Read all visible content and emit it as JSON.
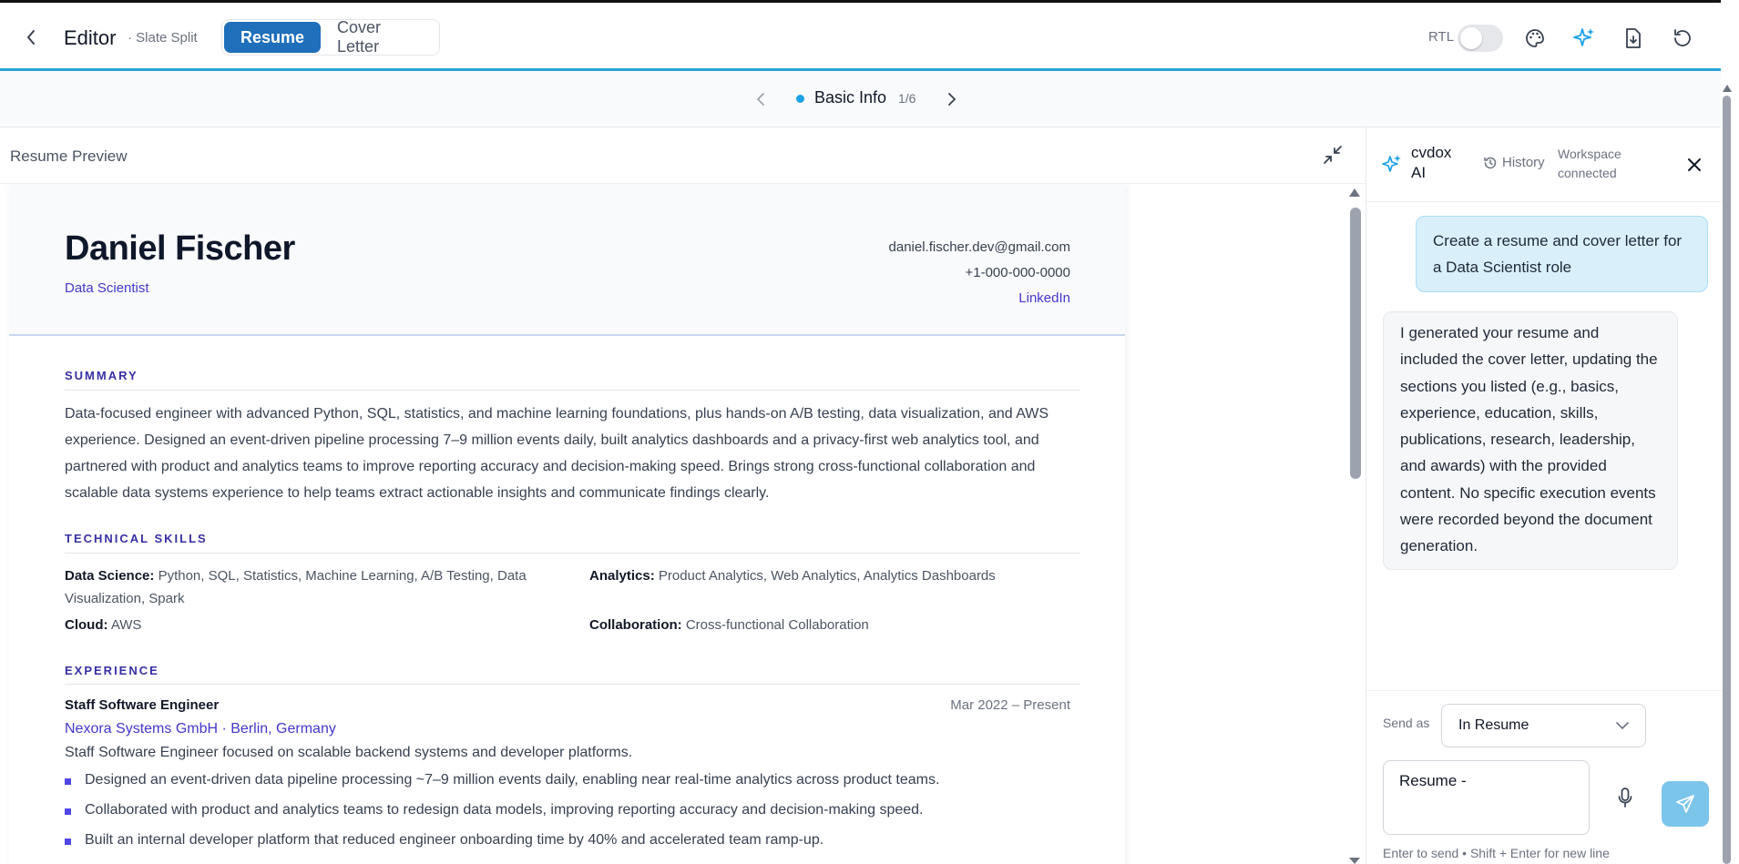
{
  "topbar": {
    "title": "Editor",
    "subtitle": "· Slate Split",
    "tabs": [
      "Resume",
      "Cover Letter"
    ],
    "rtl_label": "RTL",
    "accent_color": "#1f6fba"
  },
  "section_nav": {
    "title": "Basic Info",
    "count": "1/6",
    "dot_color": "#1da1e6"
  },
  "preview": {
    "title": "Resume Preview"
  },
  "resume": {
    "name": "Daniel Fischer",
    "role": "Data Scientist",
    "email": "daniel.fischer.dev@gmail.com",
    "phone": "+1-000-000-0000",
    "linkedin": "LinkedIn",
    "summary_title": "SUMMARY",
    "summary": "Data-focused engineer with advanced Python, SQL, statistics, and machine learning foundations, plus hands-on A/B testing, data visualization, and AWS experience. Designed an event-driven pipeline processing 7–9 million events daily, built analytics dashboards and a privacy-first web analytics tool, and partnered with product and analytics teams to improve reporting accuracy and decision-making speed. Brings strong cross-functional collaboration and scalable data systems experience to help teams extract actionable insights and communicate findings clearly.",
    "skills_title": "TECHNICAL SKILLS",
    "skills": [
      {
        "label": "Data Science:",
        "value": "Python, SQL, Statistics, Machine Learning, A/B Testing, Data Visualization, Spark"
      },
      {
        "label": "Analytics:",
        "value": "Product Analytics, Web Analytics, Analytics Dashboards"
      },
      {
        "label": "Cloud:",
        "value": "AWS"
      },
      {
        "label": "Collaboration:",
        "value": "Cross-functional Collaboration"
      }
    ],
    "experience_title": "EXPERIENCE",
    "job": {
      "title": "Staff Software Engineer",
      "dates": "Mar 2022 – Present",
      "company": "Nexora Systems GmbH · Berlin, Germany",
      "description": "Staff Software Engineer focused on scalable backend systems and developer platforms.",
      "bullets": [
        "Designed an event-driven data pipeline processing ~7–9 million events daily, enabling near real-time analytics across product teams.",
        "Collaborated with product and analytics teams to redesign data models, improving reporting accuracy and decision-making speed.",
        "Built an internal developer platform that reduced engineer onboarding time by 40% and accelerated team ramp-up."
      ]
    }
  },
  "ai_panel": {
    "name": "cvdox AI",
    "history_label": "History",
    "status": "Workspace connected",
    "user_message": "Create a resume and cover letter for a Data Scientist role",
    "ai_message": "I generated your resume and included the cover letter, updating the sections you listed (e.g., basics, experience, education, skills, publications, research, leadership, and awards) with the provided content. No specific execution events were recorded beyond the document generation.",
    "send_as_label": "Send as",
    "send_as_value": "In Resume",
    "input_value": "Resume - ",
    "hint": "Enter to send • Shift + Enter for new line"
  }
}
